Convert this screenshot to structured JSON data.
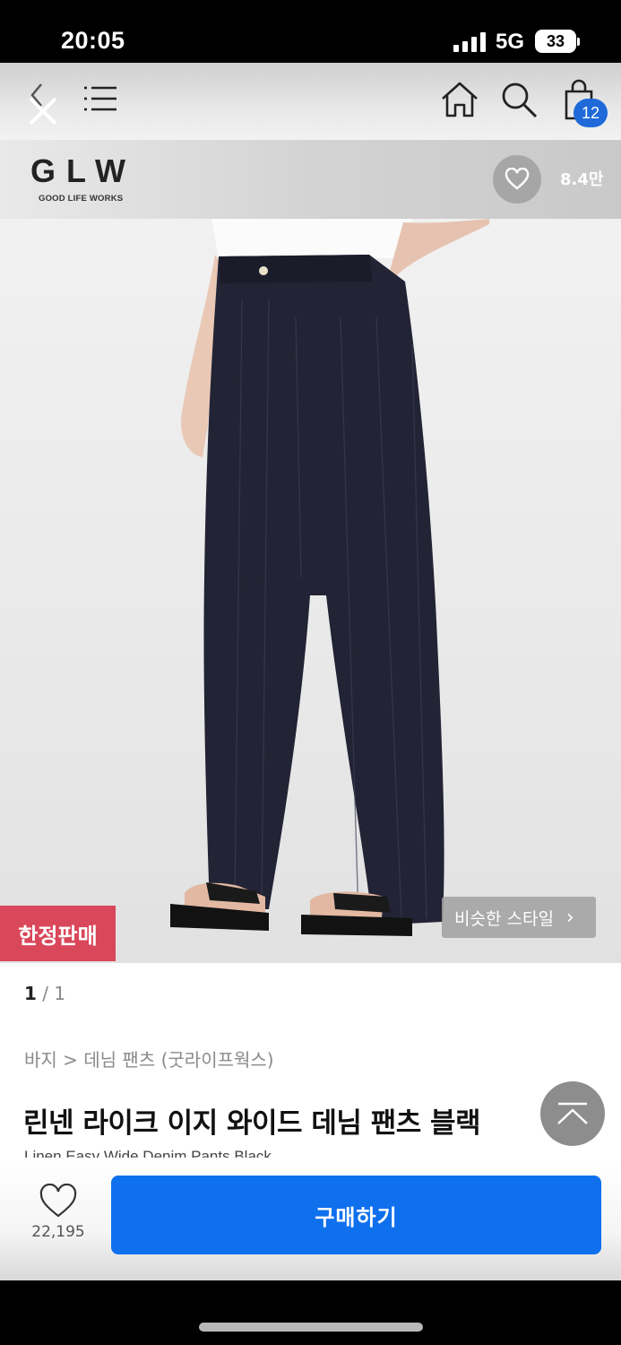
{
  "status_bar": {
    "time": "20:05",
    "network": "5G",
    "battery": "33"
  },
  "nav": {
    "cart_count": "12"
  },
  "brand": {
    "logo": "GLW",
    "tagline": "GOOD LIFE WORKS",
    "likes": "8.4만"
  },
  "image": {
    "limited_badge": "한정판매",
    "similar_style": "비슷한 스타일"
  },
  "product": {
    "pager_current": "1",
    "pager_sep": " / ",
    "pager_total": "1",
    "breadcrumb": "바지 > 데님 팬츠 (굿라이프웍스)",
    "title": "린넨 라이크 이지 와이드 데님 팬츠 블랙",
    "subtitle": "Linen Easy Wide Denim Pants Black"
  },
  "buy_bar": {
    "wish_count": "22,195",
    "buy_label": "구매하기"
  }
}
